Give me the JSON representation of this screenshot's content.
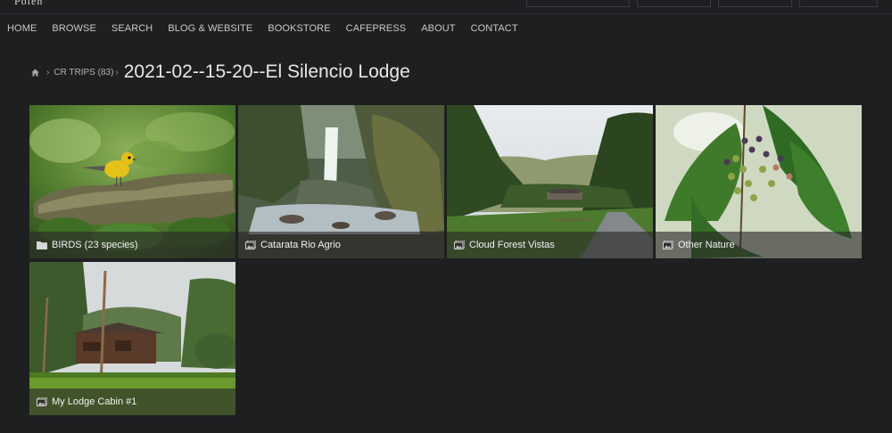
{
  "header": {
    "logo_fragment": "Polen",
    "nav": [
      "HOME",
      "BROWSE",
      "SEARCH",
      "BLOG & WEBSITE",
      "BOOKSTORE",
      "CAFEPRESS",
      "ABOUT",
      "CONTACT"
    ]
  },
  "breadcrumb": {
    "home_icon": "home-icon",
    "parent": "CR TRIPS (83)",
    "title": "2021-02--15-20--El Silencio Lodge"
  },
  "tiles": [
    {
      "label": "BIRDS (23 species)",
      "icon": "folder-icon"
    },
    {
      "label": "Catarata Rio Agrio",
      "icon": "gallery-icon"
    },
    {
      "label": "Cloud Forest Vistas",
      "icon": "gallery-icon"
    },
    {
      "label": "Other Nature",
      "icon": "gallery-icon"
    },
    {
      "label": "My Lodge Cabin #1",
      "icon": "gallery-icon"
    }
  ],
  "colors": {
    "background": "#1e1f21",
    "caption_overlay": "rgba(40,40,40,0.62)"
  }
}
